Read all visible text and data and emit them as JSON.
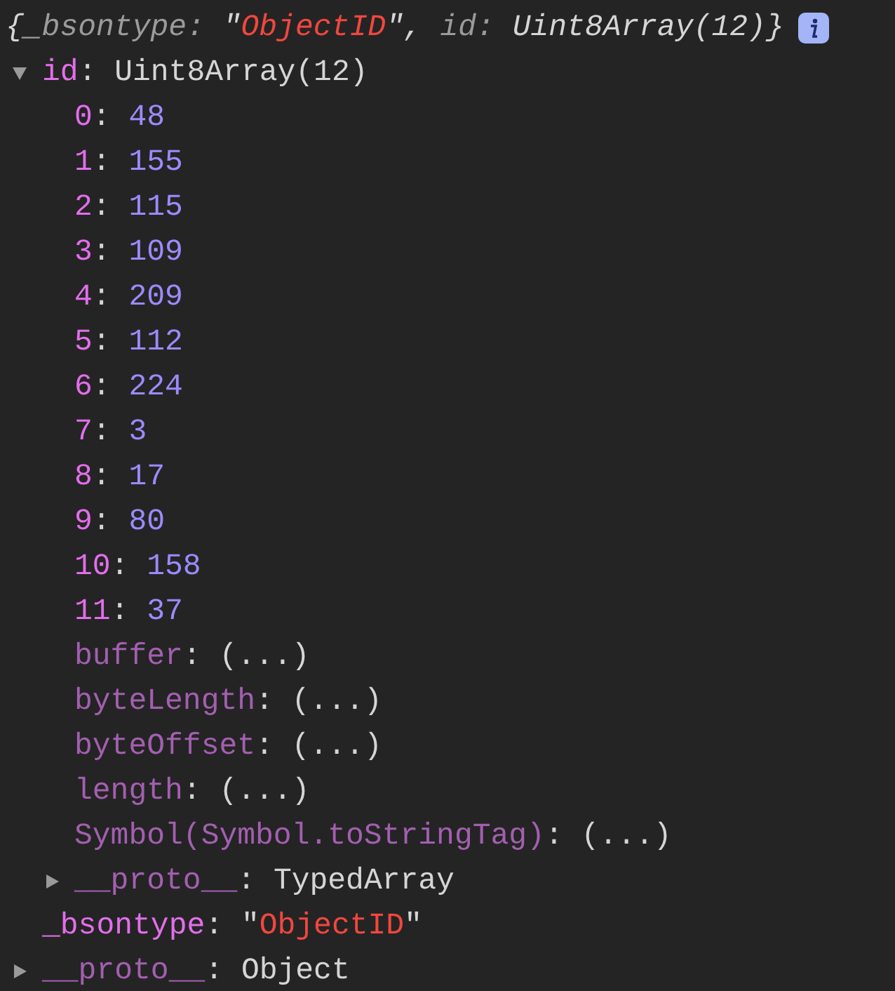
{
  "summary": {
    "open": "{",
    "entries": [
      {
        "key": "_bsontype",
        "punct": ": ",
        "value": "\"ObjectID\"",
        "kind": "string",
        "sep": ", "
      },
      {
        "key": "id",
        "punct": ": ",
        "value": "Uint8Array(12)",
        "kind": "object"
      }
    ],
    "close": "}",
    "info_badge": true
  },
  "tree": [
    {
      "key": "id",
      "inherited": false,
      "punct": ": ",
      "value": "Uint8Array(12)",
      "kind": "object",
      "expanded": true,
      "children": [
        {
          "key": "0",
          "inherited": false,
          "punct": ": ",
          "value": "48",
          "kind": "number"
        },
        {
          "key": "1",
          "inherited": false,
          "punct": ": ",
          "value": "155",
          "kind": "number"
        },
        {
          "key": "2",
          "inherited": false,
          "punct": ": ",
          "value": "115",
          "kind": "number"
        },
        {
          "key": "3",
          "inherited": false,
          "punct": ": ",
          "value": "109",
          "kind": "number"
        },
        {
          "key": "4",
          "inherited": false,
          "punct": ": ",
          "value": "209",
          "kind": "number"
        },
        {
          "key": "5",
          "inherited": false,
          "punct": ": ",
          "value": "112",
          "kind": "number"
        },
        {
          "key": "6",
          "inherited": false,
          "punct": ": ",
          "value": "224",
          "kind": "number"
        },
        {
          "key": "7",
          "inherited": false,
          "punct": ": ",
          "value": "3",
          "kind": "number"
        },
        {
          "key": "8",
          "inherited": false,
          "punct": ": ",
          "value": "17",
          "kind": "number"
        },
        {
          "key": "9",
          "inherited": false,
          "punct": ": ",
          "value": "80",
          "kind": "number"
        },
        {
          "key": "10",
          "inherited": false,
          "punct": ": ",
          "value": "158",
          "kind": "number"
        },
        {
          "key": "11",
          "inherited": false,
          "punct": ": ",
          "value": "37",
          "kind": "number"
        },
        {
          "key": "buffer",
          "inherited": true,
          "punct": ": ",
          "value": "(...)",
          "kind": "lazy"
        },
        {
          "key": "byteLength",
          "inherited": true,
          "punct": ": ",
          "value": "(...)",
          "kind": "lazy"
        },
        {
          "key": "byteOffset",
          "inherited": true,
          "punct": ": ",
          "value": "(...)",
          "kind": "lazy"
        },
        {
          "key": "length",
          "inherited": true,
          "punct": ": ",
          "value": "(...)",
          "kind": "lazy"
        },
        {
          "key": "Symbol(Symbol.toStringTag)",
          "inherited": true,
          "punct": ": ",
          "value": "(...)",
          "kind": "lazy"
        },
        {
          "key": "__proto__",
          "inherited": true,
          "punct": ": ",
          "value": "TypedArray",
          "kind": "object",
          "expanded": false
        }
      ]
    },
    {
      "key": "_bsontype",
      "inherited": false,
      "punct": ": ",
      "value": "\"ObjectID\"",
      "kind": "string"
    },
    {
      "key": "__proto__",
      "inherited": true,
      "punct": ": ",
      "value": "Object",
      "kind": "object",
      "expanded": false
    }
  ]
}
